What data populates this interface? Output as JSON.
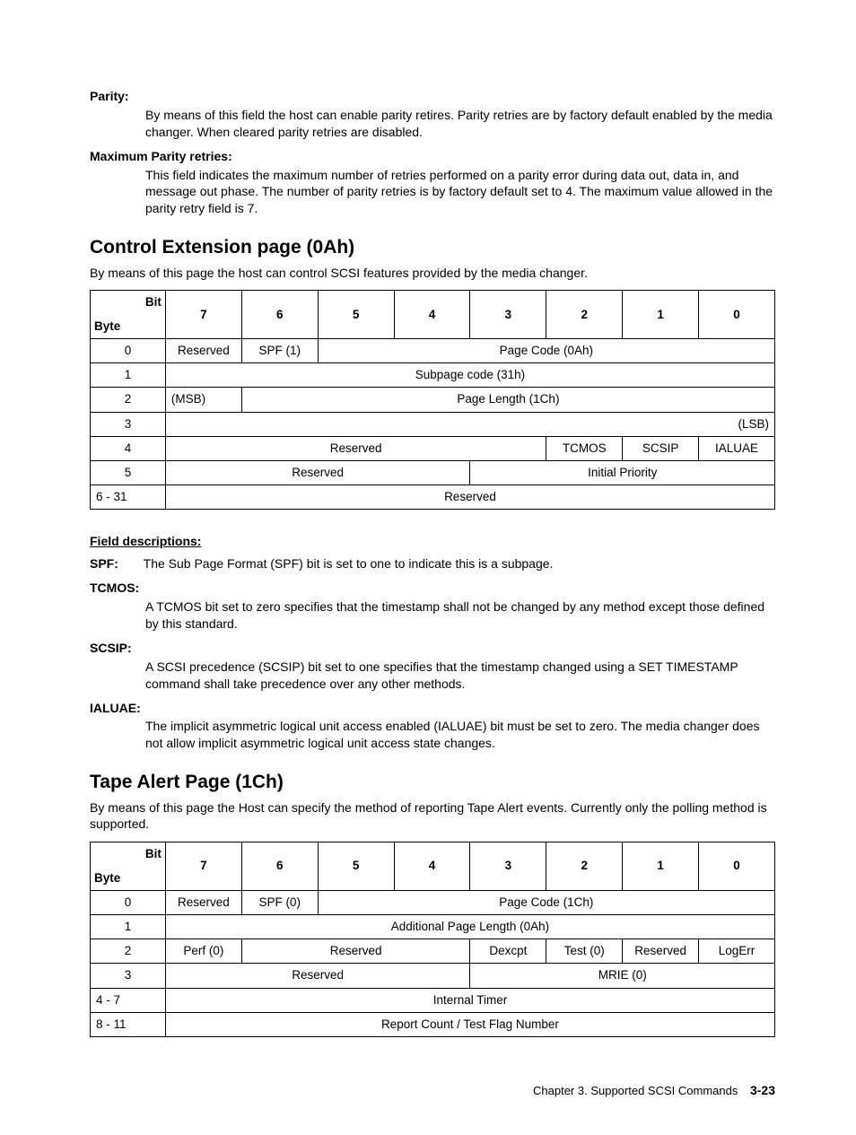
{
  "defs1": {
    "parity": {
      "term": "Parity:",
      "body": "By means of this field the host can enable parity retires. Parity retries are by factory default enabled by the media changer. When cleared parity retries are disabled."
    },
    "maxParity": {
      "term": "Maximum Parity retries:",
      "body": "This field indicates the maximum number of retries performed on a parity error during data out, data in, and message out phase. The number of parity retries is by factory default set to 4. The maximum value allowed in the parity retry field is 7."
    }
  },
  "section1": {
    "title": "Control Extension page (0Ah)",
    "lead": "By means of this page the host can control SCSI features provided by the media changer."
  },
  "t1": {
    "bitLabel": "Bit",
    "byteLabel": "Byte",
    "bits": [
      "7",
      "6",
      "5",
      "4",
      "3",
      "2",
      "1",
      "0"
    ],
    "r0": {
      "byte": "0",
      "c7": "Reserved",
      "c6": "SPF (1)",
      "span": "Page Code (0Ah)"
    },
    "r1": {
      "byte": "1",
      "span": "Subpage code (31h)"
    },
    "r2": {
      "byte": "2",
      "msb": "(MSB)",
      "span": "Page Length (1Ch)"
    },
    "r3": {
      "byte": "3",
      "lsb": "(LSB)"
    },
    "r4": {
      "byte": "4",
      "res": "Reserved",
      "c2": "TCMOS",
      "c1": "SCSIP",
      "c0": "IALUAE"
    },
    "r5": {
      "byte": "5",
      "res": "Reserved",
      "ip": "Initial Priority"
    },
    "r6": {
      "byte": "6 - 31",
      "span": "Reserved"
    }
  },
  "fieldDescHdr": "Field descriptions:",
  "defs2": {
    "spf": {
      "term": "SPF:",
      "body": "The Sub Page Format (SPF) bit is set to one to indicate this is a subpage."
    },
    "tcmos": {
      "term": "TCMOS:",
      "body": "A TCMOS bit set to zero specifies that the timestamp shall not be changed by any method except those defined by this standard."
    },
    "scsip": {
      "term": "SCSIP:",
      "body": "A SCSI precedence (SCSIP) bit set to one specifies that the timestamp changed using a SET TIMESTAMP command shall take precedence over any other methods."
    },
    "ialuae": {
      "term": "IALUAE:",
      "body": "The implicit asymmetric logical unit access enabled (IALUAE) bit must be set to zero. The media changer does not allow implicit asymmetric logical unit access state changes."
    }
  },
  "section2": {
    "title": "Tape Alert Page (1Ch)",
    "lead": "By means of this page the Host can specify the method of reporting Tape Alert events. Currently only the polling method is supported."
  },
  "t2": {
    "bitLabel": "Bit",
    "byteLabel": "Byte",
    "bits": [
      "7",
      "6",
      "5",
      "4",
      "3",
      "2",
      "1",
      "0"
    ],
    "r0": {
      "byte": "0",
      "c7": "Reserved",
      "c6": "SPF (0)",
      "span": "Page Code (1Ch)"
    },
    "r1": {
      "byte": "1",
      "span": "Additional Page Length (0Ah)"
    },
    "r2": {
      "byte": "2",
      "c7": "Perf (0)",
      "res": "Reserved",
      "c3": "Dexcpt",
      "c2": "Test (0)",
      "c1": "Reserved",
      "c0": "LogErr"
    },
    "r3": {
      "byte": "3",
      "res": "Reserved",
      "mrie": "MRIE (0)"
    },
    "r4": {
      "byte": "4 - 7",
      "span": "Internal Timer"
    },
    "r5": {
      "byte": "8 - 11",
      "span": "Report Count / Test Flag Number"
    }
  },
  "footer": {
    "chapter": "Chapter 3. Supported SCSI Commands",
    "page": "3-23"
  }
}
